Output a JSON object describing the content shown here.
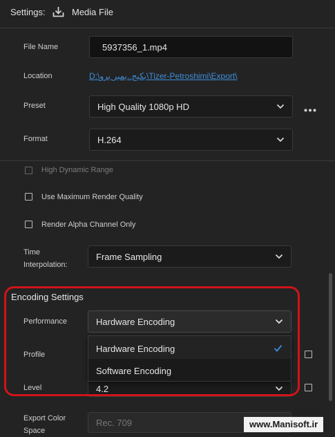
{
  "header": {
    "title": "Settings:",
    "media_icon": "download-tray-icon",
    "media_label": "Media File"
  },
  "file_name": {
    "label": "File Name",
    "value": "5937356_1.mp4"
  },
  "location": {
    "label": "Location",
    "value": "D:\\بکیج..بمبر برو\\Tizer-Petroshimi\\Export\\"
  },
  "preset": {
    "label": "Preset",
    "value": "High Quality 1080p HD",
    "more_icon": "more-horizontal-icon"
  },
  "format": {
    "label": "Format",
    "value": "H.264"
  },
  "checkboxes": {
    "hdr": "High Dynamic Range",
    "max_quality": "Use Maximum Render Quality",
    "alpha": "Render Alpha Channel Only"
  },
  "time_interpolation": {
    "label_line1": "Time",
    "label_line2": "Interpolation:",
    "value": "Frame Sampling"
  },
  "encoding": {
    "title": "Encoding Settings",
    "performance_label": "Performance",
    "performance_value": "Hardware Encoding",
    "options": [
      "Hardware Encoding",
      "Software Encoding"
    ],
    "selected_index": 0,
    "profile_label": "Profile",
    "level_label": "Level",
    "level_value": "4.2",
    "export_color_label_line1": "Export Color",
    "export_color_label_line2": "Space",
    "export_color_value": "Rec. 709"
  },
  "watermark": "www.Manisoft.ir",
  "colors": {
    "highlight": "#d0141a",
    "link": "#3f8edb",
    "check": "#3f8edb"
  }
}
